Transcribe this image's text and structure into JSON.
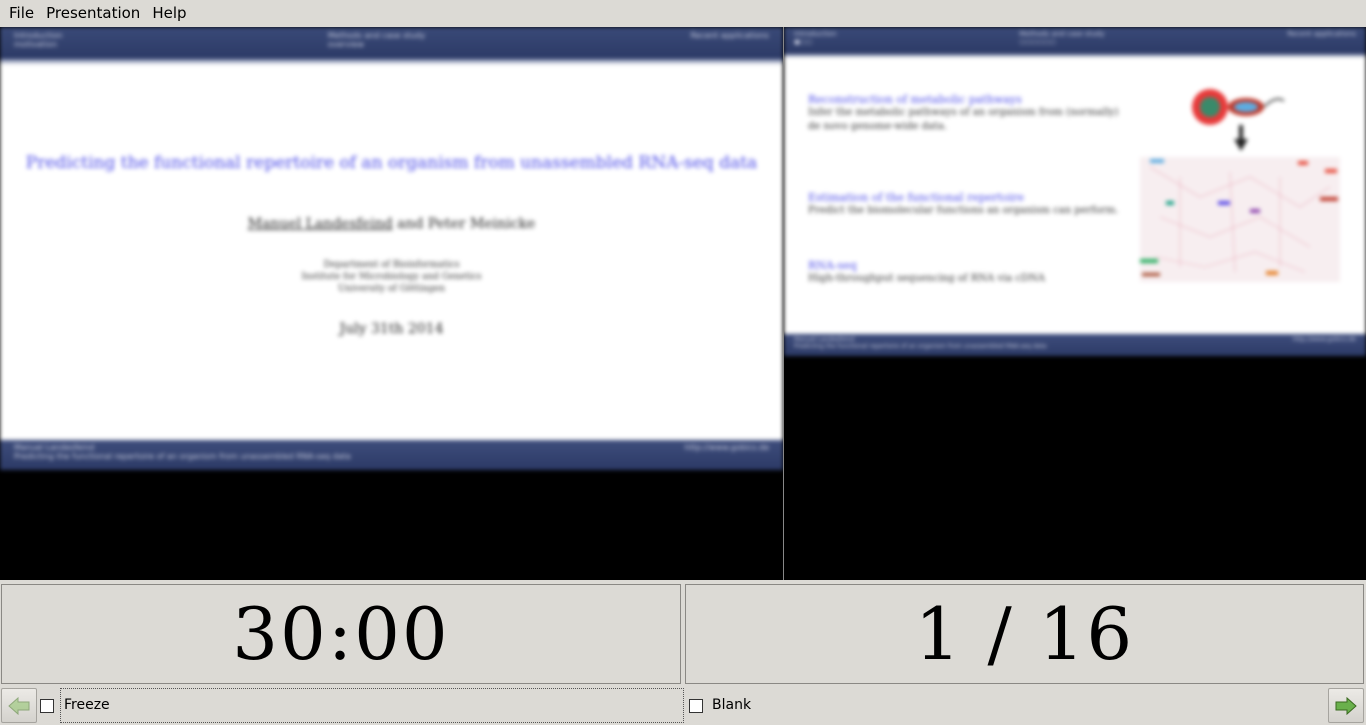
{
  "menu": {
    "items": [
      "File",
      "Presentation",
      "Help"
    ]
  },
  "current_slide": {
    "header": {
      "left": [
        "Introduction",
        "motivation"
      ],
      "center": [
        "Methods and case study",
        "overview"
      ],
      "right": [
        "Recent applications"
      ]
    },
    "title": "Predicting the functional repertoire of an organism from unassembled RNA-seq data",
    "author_main": "Manuel Landesfeind",
    "author_rest": "and Peter Meinicke",
    "institution": [
      "Department of Bioinformatics",
      "Institute for Microbiology and Genetics",
      "University of Göttingen"
    ],
    "date": "July 31th 2014",
    "footer": {
      "left": "Manuel Landesfeind",
      "right": "http://www.gobics.de",
      "bottom": "Predicting the functional repertoire of an organism from unassembled RNA-seq data"
    }
  },
  "next_slide": {
    "header": {
      "left": [
        "Introduction",
        "●○○"
      ],
      "center": [
        "Methods and case study",
        "○○○○○○"
      ],
      "right": [
        "Recent applications"
      ],
      "sub": "Reconstruction of metabolic pathways"
    },
    "blocks": [
      {
        "heading": "Reconstruction of metabolic pathways",
        "text": "Infer the metabolic pathways of an organism from (normally) de novo genome-wide data."
      },
      {
        "heading": "Estimation of the functional repertoire",
        "text": "Predict the biomolecular functions an organism can perform."
      },
      {
        "heading": "RNA-seq",
        "text": "High-throughput sequencing of RNA via cDNA"
      }
    ],
    "footer": {
      "left": "Manuel Landesfeind",
      "right": "http://www.gobics.de",
      "bottom": "Predicting the functional repertoire of an organism from unassembled RNA-seq data"
    }
  },
  "timer": "30:00",
  "slide_counter": "1 / 16",
  "controls": {
    "freeze_label": "Freeze",
    "blank_label": "Blank",
    "freeze_checked": false,
    "blank_checked": false
  },
  "colors": {
    "beamer_blue": "#2c3a66",
    "title_blue": "#4a4ae8",
    "window_bg": "#dcdad5",
    "arrow_green": "#6ab04c"
  },
  "icons": {
    "prev": "left-arrow-icon",
    "next": "right-arrow-icon"
  }
}
